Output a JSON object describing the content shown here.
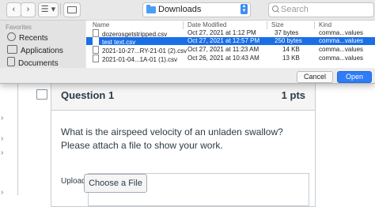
{
  "dialog": {
    "toolbar": {
      "back": "‹",
      "forward": "›",
      "view_menu": "☰ ▾",
      "location": "Downloads",
      "search_placeholder": "Search"
    },
    "sidebar": {
      "heading": "Favorites",
      "items": [
        "Recents",
        "Applications",
        "Documents"
      ]
    },
    "columns": [
      "Name",
      "Date Modified",
      "Size",
      "Kind"
    ],
    "rows": [
      {
        "name": "dozerosgetstripped.csv",
        "date": "Oct 27, 2021 at 1:12 PM",
        "size": "37 bytes",
        "kind": "comma...values"
      },
      {
        "name": "test text.csv",
        "date": "Oct 27, 2021 at 12:57 PM",
        "size": "250 bytes",
        "kind": "comma...values"
      },
      {
        "name": "2021-10-27...RY-21-01 (2).csv",
        "date": "Oct 27, 2021 at 11:23 AM",
        "size": "14 KB",
        "kind": "comma...values"
      },
      {
        "name": "2021-01-04...1A-01 (1).csv",
        "date": "Oct 26, 2021 at 10:43 AM",
        "size": "13 KB",
        "kind": "comma...values"
      }
    ],
    "selected_row": "test text.csv",
    "cancel_label": "Cancel",
    "open_label": "Open"
  },
  "question": {
    "title": "Question 1",
    "points": "1 pts",
    "text": "What is the airspeed velocity of an unladen swallow? Please attach a file to show your work.",
    "upload_label": "Upload",
    "choose_file_label": "Choose a File"
  },
  "colors": {
    "selection": "#1a6ee6",
    "open_button": "#2f7cf6",
    "folder": "#4a9ff5"
  }
}
